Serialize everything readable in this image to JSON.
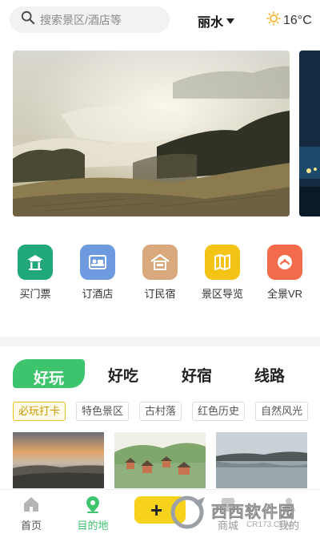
{
  "search": {
    "placeholder": "搜索景区/酒店等",
    "icon": "search-icon"
  },
  "location": {
    "city": "丽水",
    "icon": "chevron-down-icon"
  },
  "weather": {
    "temperature": "16°C",
    "icon": "sun-icon"
  },
  "banner": {
    "description_icon": "landscape-photo"
  },
  "quick_entries": [
    {
      "label": "买门票",
      "icon": "ticket-pavilion-icon",
      "color": "#21a87a"
    },
    {
      "label": "订酒店",
      "icon": "hotel-bed-icon",
      "color": "#6e9be0"
    },
    {
      "label": "订民宿",
      "icon": "homestay-house-icon",
      "color": "#d9a87c"
    },
    {
      "label": "景区导览",
      "icon": "map-guide-icon",
      "color": "#f3c316"
    },
    {
      "label": "全景VR",
      "icon": "vr-panorama-icon",
      "color": "#f26b4a"
    }
  ],
  "tabs": [
    {
      "label": "好玩",
      "active": true
    },
    {
      "label": "好吃",
      "active": false
    },
    {
      "label": "好宿",
      "active": false
    },
    {
      "label": "线路",
      "active": false
    }
  ],
  "chips": [
    {
      "label": "必玩打卡",
      "active": true
    },
    {
      "label": "特色景区",
      "active": false
    },
    {
      "label": "古村落",
      "active": false
    },
    {
      "label": "红色历史",
      "active": false
    },
    {
      "label": "自然风光",
      "active": false
    }
  ],
  "bottom_nav": [
    {
      "label": "首页",
      "icon": "home-icon",
      "active": false
    },
    {
      "label": "目的地",
      "icon": "location-pin-icon",
      "active": true
    },
    {
      "label": "+",
      "icon": "plus-icon",
      "active": false
    },
    {
      "label": "商城",
      "icon": "shop-icon",
      "active": false
    },
    {
      "label": "我的",
      "icon": "user-icon",
      "active": false
    }
  ],
  "watermark": {
    "text": "西西软件园",
    "url": "CR173.COM"
  },
  "colors": {
    "accent": "#3ec46d",
    "chip_active": "#f2c21c",
    "fab": "#f7d21c"
  }
}
